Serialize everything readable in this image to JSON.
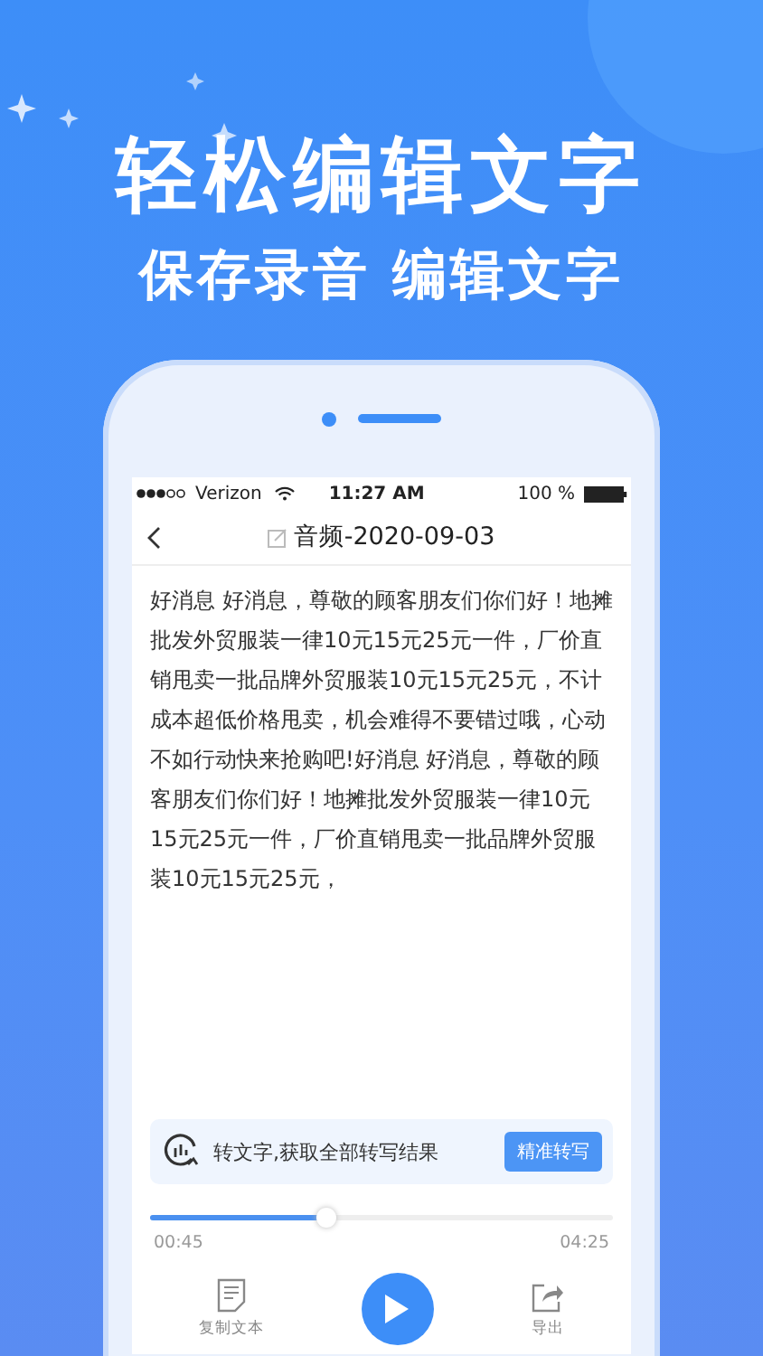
{
  "headline": "轻松编辑文字",
  "subtitle": "保存录音  编辑文字",
  "status_bar": {
    "carrier": "Verizon",
    "time": "11:27 AM",
    "battery": "100 %"
  },
  "nav": {
    "title": "音频-2020-09-03"
  },
  "transcript": "好消息 好消息，尊敬的顾客朋友们你们好！地摊批发外贸服装一律10元15元25元一件，厂价直销甩卖一批品牌外贸服装10元15元25元，不计成本超低价格甩卖，机会难得不要错过哦，心动不如行动快来抢购吧!好消息 好消息，尊敬的顾客朋友们你们好！地摊批发外贸服装一律10元15元25元一件，厂价直销甩卖一批品牌外贸服装10元15元25元，",
  "transcribe_card": {
    "text": "转文字,获取全部转写结果",
    "button": "精准转写"
  },
  "player": {
    "level": 0.38,
    "elapsed": "00:45",
    "total": "04:25"
  },
  "actions": [
    {
      "kind": "copy",
      "label": "复制文本"
    },
    {
      "kind": "play"
    },
    {
      "kind": "export",
      "label": "导出"
    }
  ]
}
